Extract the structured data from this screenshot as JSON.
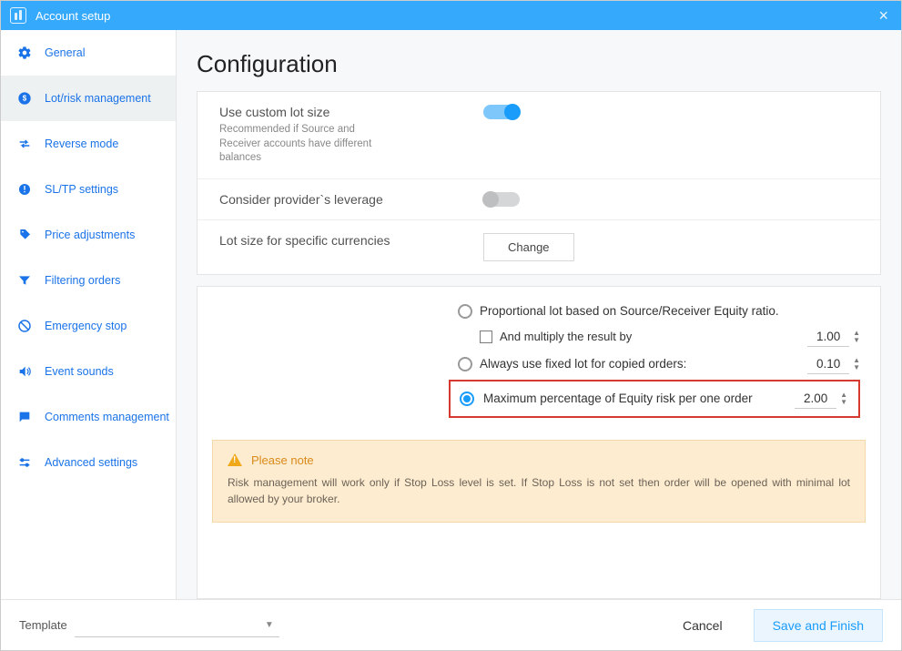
{
  "window": {
    "title": "Account setup"
  },
  "sidebar": {
    "items": [
      {
        "label": "General"
      },
      {
        "label": "Lot/risk management"
      },
      {
        "label": "Reverse mode"
      },
      {
        "label": "SL/TP settings"
      },
      {
        "label": "Price adjustments"
      },
      {
        "label": "Filtering orders"
      },
      {
        "label": "Emergency stop"
      },
      {
        "label": "Event sounds"
      },
      {
        "label": "Comments management"
      },
      {
        "label": "Advanced settings"
      }
    ]
  },
  "main": {
    "heading": "Configuration",
    "custom_lot": {
      "label": "Use custom lot size",
      "sub": "Recommended if Source and Receiver accounts have different balances",
      "enabled": true
    },
    "provider_leverage": {
      "label": "Consider provider`s leverage",
      "enabled": false
    },
    "specific_currencies": {
      "label": "Lot size for specific currencies",
      "button": "Change"
    },
    "options": {
      "proportional": {
        "label": "Proportional lot based on Source/Receiver Equity ratio."
      },
      "multiply": {
        "label": "And multiply the result by",
        "value": "1.00"
      },
      "fixed": {
        "label": "Always use fixed lot for copied orders:",
        "value": "0.10"
      },
      "max_risk": {
        "label": "Maximum percentage of Equity risk per one order",
        "value": "2.00",
        "selected": true
      }
    },
    "note": {
      "title": "Please note",
      "body": "Risk management will work only if Stop Loss level is set. If Stop Loss is not set then order will be opened with minimal lot allowed by your broker."
    }
  },
  "footer": {
    "template_label": "Template",
    "cancel": "Cancel",
    "save": "Save and Finish"
  }
}
